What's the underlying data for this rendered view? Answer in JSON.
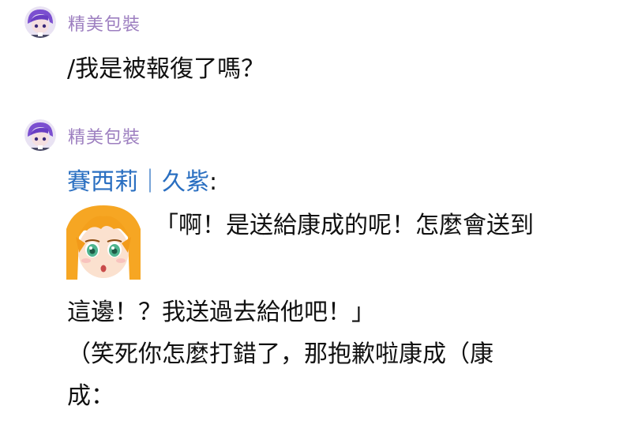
{
  "colors": {
    "sender_name": "#9d7fc0",
    "speaker_name": "#2a6fc1",
    "text": "#111111",
    "background": "#ffffff"
  },
  "messages": [
    {
      "sender": "精美包裝",
      "avatar_icon": "purple-hair-character-avatar-icon",
      "lines": [
        "/我是被報復了嗎？"
      ]
    },
    {
      "sender": "精美包裝",
      "avatar_icon": "purple-hair-character-avatar-icon",
      "speaker": {
        "name": "賽西莉｜久紫",
        "colon": ":"
      },
      "portrait_icon": "orange-hair-girl-portrait-icon",
      "portrait_line": "「啊！是送給康成的呢！怎麼會送到",
      "lines": [
        "這邊！？我送過去給他吧！」",
        "（笑死你怎麼打錯了，那抱歉啦康成（康",
        "成："
      ]
    }
  ]
}
